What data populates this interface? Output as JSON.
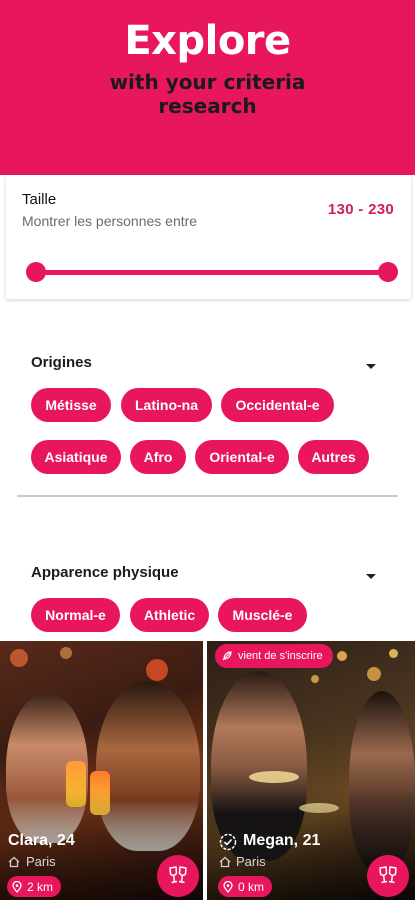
{
  "header": {
    "title": "Explore",
    "subtitle_line1": "with your criteria",
    "subtitle_line2": "research"
  },
  "size_filter": {
    "label": "Taille",
    "description": "Montrer les personnes entre",
    "range_text": "130 - 230",
    "min": 130,
    "max": 230
  },
  "origins": {
    "title": "Origines",
    "chips": [
      "Métisse",
      "Latino-na",
      "Occidental-e",
      "Asiatique",
      "Afro",
      "Oriental-e",
      "Autres"
    ]
  },
  "appearance": {
    "title": "Apparence physique",
    "chips": [
      "Normal-e",
      "Athletic",
      "Musclé-e"
    ]
  },
  "profiles": [
    {
      "name": "Clara, 24",
      "city": "Paris",
      "distance": "2 km",
      "badge": ""
    },
    {
      "name": "Megan, 21",
      "city": "Paris",
      "distance": "0 km",
      "badge": "vient de s'inscrire"
    }
  ],
  "colors": {
    "accent": "#e8175d",
    "range_text": "#d21f5c"
  },
  "icons": [
    "caret-down-icon",
    "home-icon",
    "location-pin-icon",
    "cheers-icon",
    "verified-icon",
    "feather-icon"
  ]
}
